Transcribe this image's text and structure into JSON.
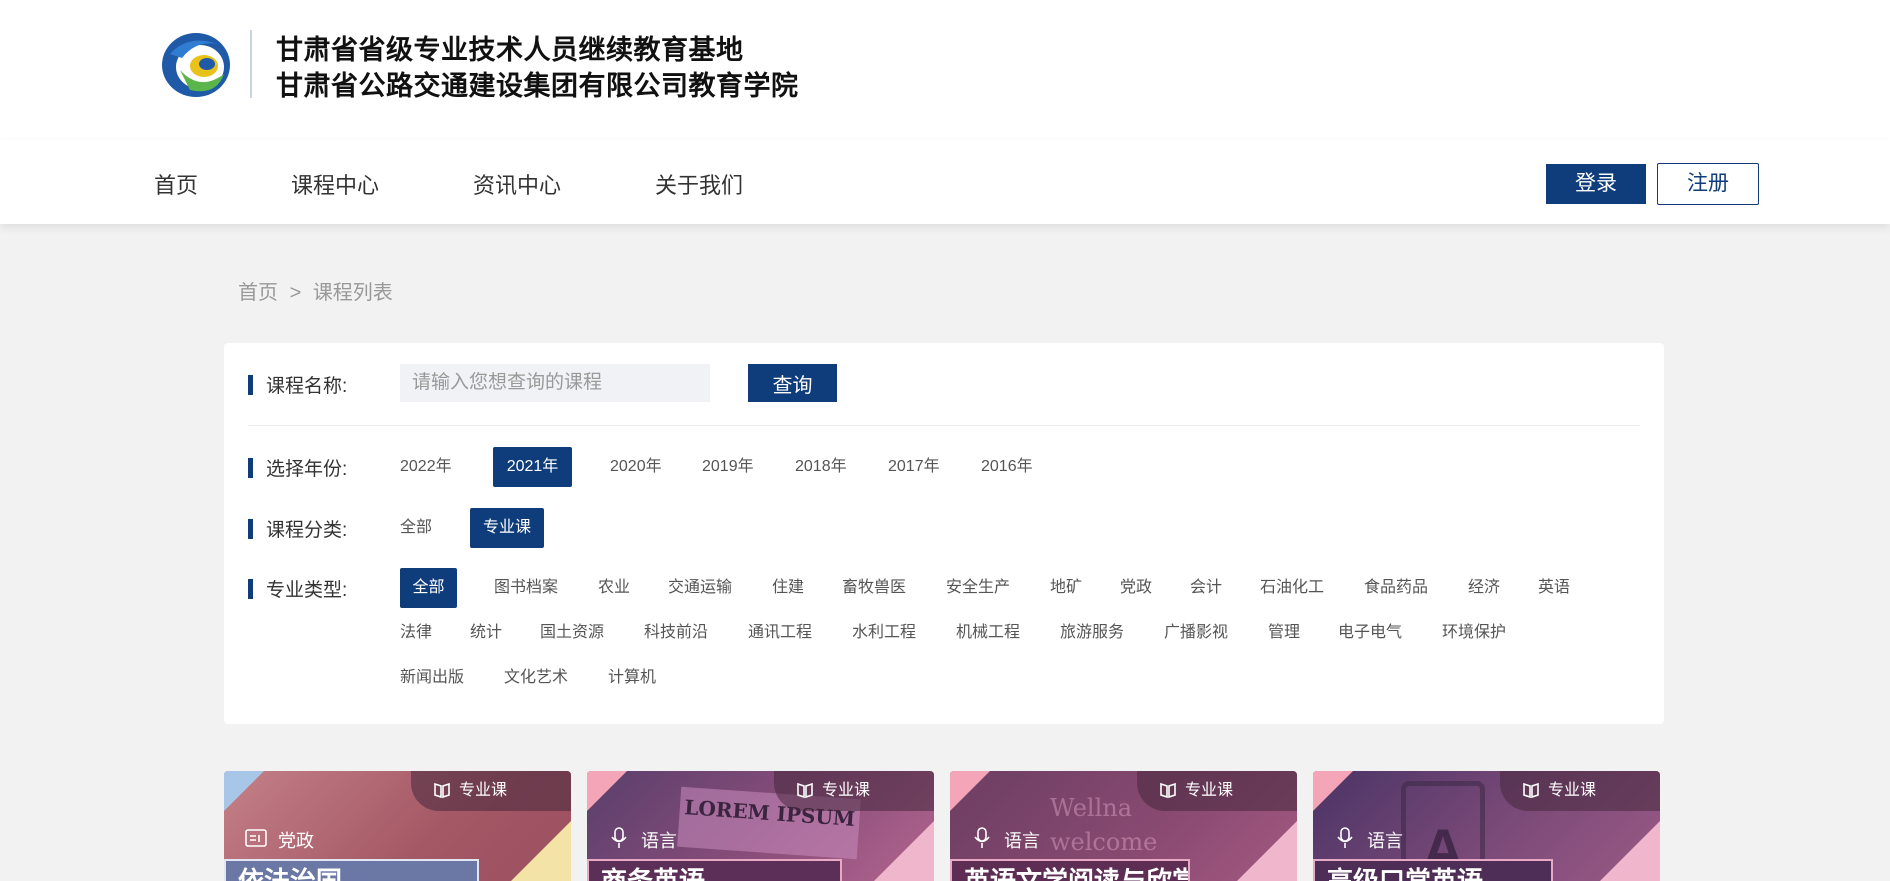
{
  "header": {
    "org_line1": "甘肃省省级专业技术人员继续教育基地",
    "org_line2": "甘肃省公路交通建设集团有限公司教育学院"
  },
  "nav": {
    "items": [
      "首页",
      "课程中心",
      "资讯中心",
      "关于我们"
    ],
    "login": "登录",
    "register": "注册"
  },
  "breadcrumb": {
    "home": "首页",
    "separator": ">",
    "current": "课程列表"
  },
  "filters": {
    "name_label": "课程名称:",
    "search_placeholder": "请输入您想查询的课程",
    "search_button": "查询",
    "year_label": "选择年份:",
    "years": [
      "2022年",
      "2021年",
      "2020年",
      "2019年",
      "2018年",
      "2017年",
      "2016年"
    ],
    "selected_year": "2021年",
    "category_label": "课程分类:",
    "categories": [
      "全部",
      "专业课"
    ],
    "selected_category": "专业课",
    "major_label": "专业类型:",
    "majors": [
      "全部",
      "图书档案",
      "农业",
      "交通运输",
      "住建",
      "畜牧兽医",
      "安全生产",
      "地矿",
      "党政",
      "会计",
      "石油化工",
      "食品药品",
      "经济",
      "英语",
      "法律",
      "统计",
      "国土资源",
      "科技前沿",
      "通讯工程",
      "水利工程",
      "机械工程",
      "旅游服务",
      "广播影视",
      "管理",
      "电子电气",
      "环境保护",
      "新闻出版",
      "文化艺术",
      "计算机"
    ],
    "selected_major": "全部"
  },
  "cards": [
    {
      "tag": "专业课",
      "category": "党政",
      "title": "依法治国",
      "bg": "#b06a73",
      "tag_icon": "book-icon",
      "cat_icon": "id-card-icon"
    },
    {
      "tag": "专业课",
      "category": "语言",
      "title": "商务英语",
      "bg": "#7a3f6e",
      "tag_icon": "book-icon",
      "cat_icon": "microphone-icon",
      "image_text": "LOREM IPSUM"
    },
    {
      "tag": "专业课",
      "category": "语言",
      "title": "英语文学阅读与欣赏",
      "bg": "#7b3a64",
      "tag_icon": "book-icon",
      "cat_icon": "microphone-icon",
      "image_text": "Wellna welcome"
    },
    {
      "tag": "专业课",
      "category": "语言",
      "title": "高级口常英语",
      "bg": "#6f3b6d",
      "tag_icon": "book-icon",
      "cat_icon": "microphone-icon",
      "image_text": "A"
    }
  ],
  "colors": {
    "primary": "#0f3c7a",
    "page_bg": "#f2f2f2"
  }
}
